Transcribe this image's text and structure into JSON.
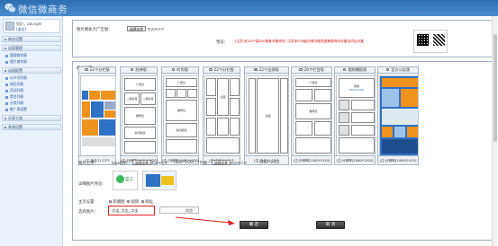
{
  "header": {
    "title": "微信微商务"
  },
  "sidebar": {
    "user_name": "您好，ubunger",
    "logout": "[退出]",
    "sections": [
      {
        "label": "商业设置",
        "items": []
      },
      {
        "label": "店家管理",
        "items": [
          "管理商列表",
          "图片商列表"
        ]
      },
      {
        "label": "店面配置",
        "items": [
          "公众号列表",
          "商品列表",
          "活动列表",
          "类目列表",
          "分类列表",
          "推广表设置"
        ]
      },
      {
        "label": "分享工具",
        "items": []
      },
      {
        "label": "系统设置",
        "items": []
      }
    ]
  },
  "top_form": {
    "big_ad_label": "图片模板大广告图：",
    "choose_file": "选择文件",
    "no_file": "未选择文件",
    "preview_label": "预览：",
    "hint": "(注意:宽200*高600像素不要修改) 注意单行间距的情况要根据需要修改设置选项目设置"
  },
  "template_section": {
    "title": "模板设置",
    "subtitle": "模板风格：",
    "templates": [
      {
        "name": "22个分栏版",
        "size": "(注:适合21,22个",
        "selected": false
      },
      {
        "name": "经典版",
        "size": "(注:分辨率[1080*1920]",
        "selected": false
      },
      {
        "name": "时尚版",
        "size": "(注:分辨率[1080*1920]",
        "selected": false
      },
      {
        "name": "22个分栏版",
        "size": "(注:适合21,22个",
        "selected": false
      },
      {
        "name": "22个全屏版",
        "size": "(注:适合21,22个",
        "selected": true
      },
      {
        "name": "20个栏目版",
        "size": "(注:分辨率[1080*1920]",
        "selected": false
      },
      {
        "name": "视频播报版",
        "size": "(注:分辨率[1080*1920]",
        "selected": false
      },
      {
        "name": "官方公告版",
        "size": "(注:分辨率[1080*1920]",
        "selected": false
      }
    ],
    "block_labels": {
      "ad": "广告位",
      "news": "二级栏目",
      "main": "主图",
      "recommend": "推荐位",
      "news_channel": "新闻频道",
      "video_title": "视频",
      "video_size": "2560x1920",
      "square": "方形图"
    }
  },
  "upload_form": {
    "image_upload_label": "图片上传：",
    "logo_label": "logo图片：",
    "logo_size": "(200*100)",
    "ad_label": "广告图：",
    "ad_size": "(310*245)",
    "detail_preview_label": "详细图片预览：",
    "detail_preview_text": "是三",
    "main_settings_label": "主页设置：",
    "options": [
      "轮播图",
      "视频",
      "网址"
    ],
    "selected_option": "轮播图",
    "choose_image_label": "选择图片：",
    "choose_image_value": "点击_点击_点击",
    "browse_label": "浏览"
  },
  "actions": {
    "confirm": "确 定",
    "cancel": "取 消"
  },
  "colors": {
    "header_bg": "#3a7cc0",
    "accent_red": "#dd2222",
    "orange": "#f0921e",
    "blue": "#2f71c4"
  }
}
